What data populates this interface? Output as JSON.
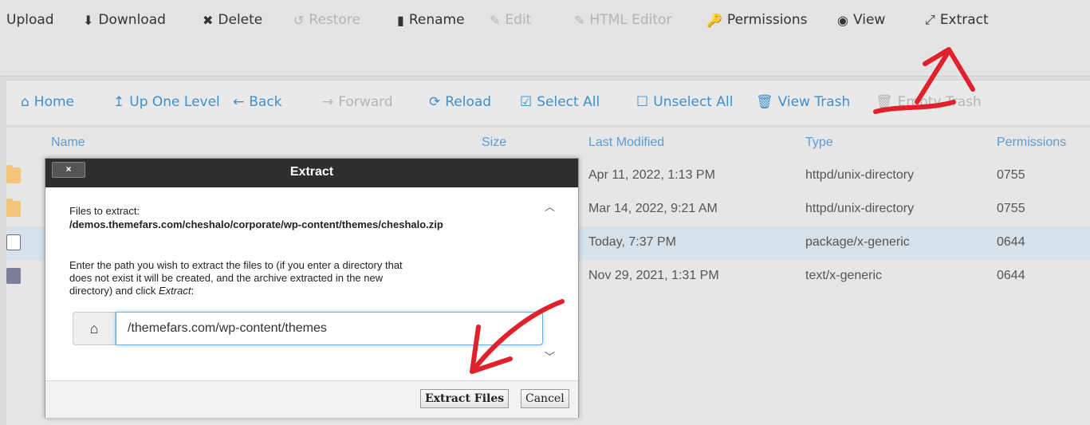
{
  "toolbar": {
    "items": [
      {
        "label": "Upload",
        "icon": "upload-icon",
        "glyph": "",
        "disabled": false
      },
      {
        "label": "Download",
        "icon": "download-icon",
        "glyph": "⬇",
        "disabled": false
      },
      {
        "label": "Delete",
        "icon": "delete-icon",
        "glyph": "✖",
        "disabled": false
      },
      {
        "label": "Restore",
        "icon": "restore-icon",
        "glyph": "↺",
        "disabled": true
      },
      {
        "label": "Rename",
        "icon": "rename-icon",
        "glyph": "▮",
        "disabled": false
      },
      {
        "label": "Edit",
        "icon": "edit-icon",
        "glyph": "✎",
        "disabled": true
      },
      {
        "label": "HTML Editor",
        "icon": "html-editor-icon",
        "glyph": "✎",
        "disabled": true
      },
      {
        "label": "Permissions",
        "icon": "key-icon",
        "glyph": "🔑",
        "disabled": false
      },
      {
        "label": "View",
        "icon": "eye-icon",
        "glyph": "◉",
        "disabled": false
      },
      {
        "label": "Extract",
        "icon": "extract-icon",
        "glyph": "⤢",
        "disabled": false
      }
    ]
  },
  "nav": {
    "items": [
      {
        "label": "Home",
        "icon": "home-icon",
        "glyph": "⌂",
        "disabled": false
      },
      {
        "label": "Up One Level",
        "icon": "up-level-icon",
        "glyph": "↥",
        "disabled": false
      },
      {
        "label": "Back",
        "icon": "back-arrow-icon",
        "glyph": "←",
        "disabled": false
      },
      {
        "label": "Forward",
        "icon": "forward-arrow-icon",
        "glyph": "→",
        "disabled": true
      },
      {
        "label": "Reload",
        "icon": "reload-icon",
        "glyph": "⟳",
        "disabled": false
      },
      {
        "label": "Select All",
        "icon": "checkbox-checked-icon",
        "glyph": "☑",
        "disabled": false
      },
      {
        "label": "Unselect All",
        "icon": "checkbox-empty-icon",
        "glyph": "☐",
        "disabled": false
      },
      {
        "label": "View Trash",
        "icon": "trash-icon",
        "glyph": "🗑",
        "disabled": false
      },
      {
        "label": "Empty Trash",
        "icon": "empty-trash-icon",
        "glyph": "🗑",
        "disabled": true
      }
    ]
  },
  "table": {
    "headers": {
      "name": "Name",
      "size": "Size",
      "modified": "Last Modified",
      "type": "Type",
      "permissions": "Permissions"
    },
    "rows": [
      {
        "icon": "folder-icon",
        "kind": "folder",
        "modified": "Apr 11, 2022, 1:13 PM",
        "type": "httpd/unix-directory",
        "perms": "0755",
        "selected": false
      },
      {
        "icon": "folder-icon",
        "kind": "folder",
        "modified": "Mar 14, 2022, 9:21 AM",
        "type": "httpd/unix-directory",
        "perms": "0755",
        "selected": false
      },
      {
        "icon": "zip-file-icon",
        "kind": "zip",
        "modified": "Today, 7:37 PM",
        "type": "package/x-generic",
        "perms": "0644",
        "selected": true
      },
      {
        "icon": "text-file-icon",
        "kind": "doc",
        "modified": "Nov 29, 2021, 1:31 PM",
        "type": "text/x-generic",
        "perms": "0644",
        "selected": false
      }
    ]
  },
  "dialog": {
    "title": "Extract",
    "close_label": "×",
    "files_label": "Files to extract:",
    "files_path": "/demos.themefars.com/cheshalo/corporate/wp-content/themes/cheshalo.zip",
    "instructions_line1": "Enter the path you wish to extract the files to (if you enter a directory that",
    "instructions_line2": "does not exist it will be created, and the archive extracted in the new",
    "instructions_line3_prefix": "directory) and click ",
    "instructions_line3_em": "Extract",
    "instructions_line3_suffix": ":",
    "path_value": "/themefars.com/wp-content/themes",
    "home_glyph": "⌂",
    "extract_button": "Extract Files",
    "cancel_button": "Cancel"
  },
  "colors": {
    "link": "#3f8fc9",
    "disabled": "#b4b4b4",
    "annotation": "#e0202a",
    "header": "#5b9bd5"
  }
}
